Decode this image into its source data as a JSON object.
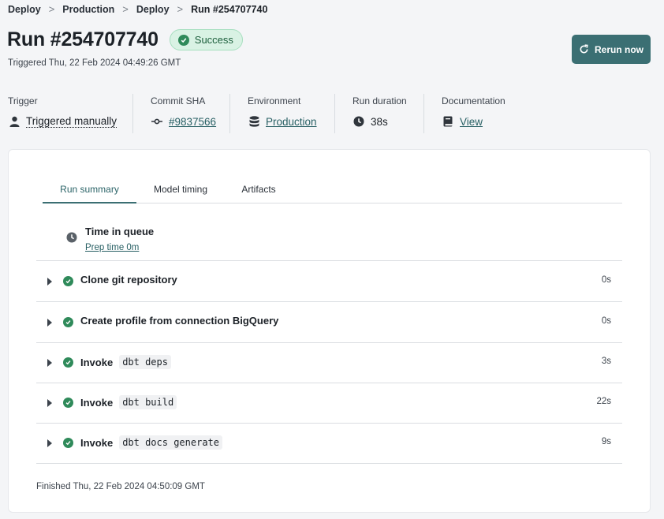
{
  "breadcrumb": [
    "Deploy",
    "Production",
    "Deploy",
    "Run #254707740"
  ],
  "header": {
    "title": "Run #254707740",
    "status": "Success",
    "triggered": "Triggered Thu, 22 Feb 2024 04:49:26 GMT",
    "rerun_label": "Rerun now"
  },
  "meta": {
    "trigger": {
      "label": "Trigger",
      "value": "Triggered manually",
      "icon": "person-icon"
    },
    "commit": {
      "label": "Commit SHA",
      "value": "#9837566",
      "icon": "commit-icon"
    },
    "environment": {
      "label": "Environment",
      "value": "Production",
      "icon": "database-icon"
    },
    "duration": {
      "label": "Run duration",
      "value": "38s",
      "icon": "clock-icon"
    },
    "documentation": {
      "label": "Documentation",
      "value": "View",
      "icon": "book-icon"
    }
  },
  "tabs": [
    "Run summary",
    "Model timing",
    "Artifacts"
  ],
  "queue": {
    "title": "Time in queue",
    "subtitle": "Prep time 0m"
  },
  "steps": [
    {
      "label": "Clone git repository",
      "code": "",
      "duration": "0s"
    },
    {
      "label": "Create profile from connection BigQuery",
      "code": "",
      "duration": "0s"
    },
    {
      "label": "Invoke",
      "code": "dbt deps",
      "duration": "3s"
    },
    {
      "label": "Invoke",
      "code": "dbt build",
      "duration": "22s"
    },
    {
      "label": "Invoke",
      "code": "dbt docs generate",
      "duration": "9s"
    }
  ],
  "finished": "Finished Thu, 22 Feb 2024 04:50:09 GMT",
  "colors": {
    "accent": "#3b6f73",
    "success": "#2f8a5a",
    "badge_bg": "#d9f2e4"
  }
}
